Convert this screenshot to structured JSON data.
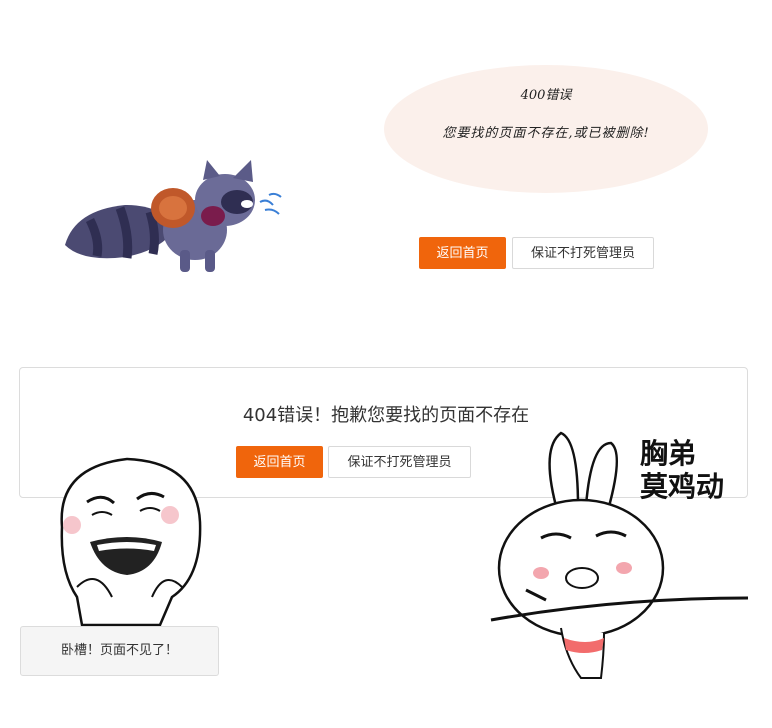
{
  "top": {
    "bubble_line1": "400错误",
    "bubble_line2": "您要找的页面不存在,或已被删除!",
    "home_button": "返回首页",
    "admin_button": "保证不打死管理员"
  },
  "middle": {
    "title": "404错误！抱歉您要找的页面不存在",
    "home_button": "返回首页",
    "admin_button": "保证不打死管理员"
  },
  "bottom": {
    "box_text": "卧槽！页面不见了！",
    "caption_line1": "胸弟",
    "caption_line2": "莫鸡动"
  },
  "colors": {
    "accent": "#f0650c",
    "bubble_bg": "#fbf0eb"
  },
  "icons": {
    "raccoon": "crying-raccoon-illustration",
    "face": "crying-meme-face",
    "bunny": "smoking-bunny-meme"
  }
}
